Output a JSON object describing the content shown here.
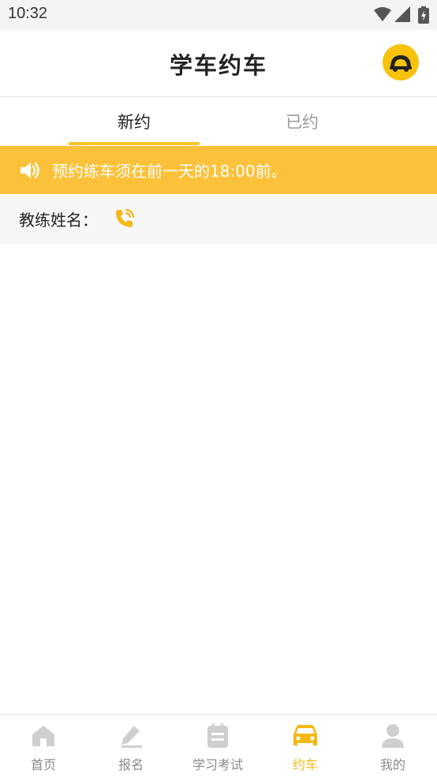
{
  "status_bar": {
    "time": "10:32"
  },
  "header": {
    "title": "学车约车",
    "logo_icon": "driving-school-logo-icon"
  },
  "tabs": [
    {
      "label": "新约",
      "active": true
    },
    {
      "label": "已约",
      "active": false
    }
  ],
  "notice": {
    "icon": "speaker-icon",
    "text": "预约练车须在前一天的18:00前。"
  },
  "coach": {
    "label": "教练姓名：",
    "name": "",
    "phone_icon": "phone-icon"
  },
  "bottom_nav": [
    {
      "label": "首页",
      "icon": "home-icon",
      "active": false
    },
    {
      "label": "报名",
      "icon": "edit-icon",
      "active": false
    },
    {
      "label": "学习考试",
      "icon": "notes-icon",
      "active": false
    },
    {
      "label": "约车",
      "icon": "car-icon",
      "active": true
    },
    {
      "label": "我的",
      "icon": "user-icon",
      "active": false
    }
  ],
  "colors": {
    "accent": "#fbc02d",
    "notice_bg": "#fcc13a",
    "inactive": "#d0d0d0"
  }
}
